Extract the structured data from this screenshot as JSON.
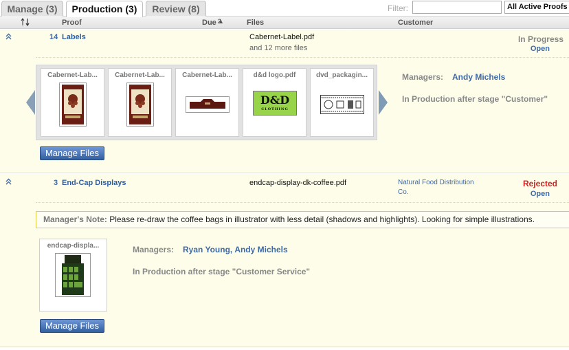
{
  "tabs": [
    {
      "label": "Manage (3)"
    },
    {
      "label": "Production (3)"
    },
    {
      "label": "Review (8)"
    }
  ],
  "filter": {
    "label": "Filter:",
    "value": "",
    "select_value": "All Active Proofs"
  },
  "columns": {
    "proof": "Proof",
    "due": "Due",
    "due_sort_number": "2",
    "files": "Files",
    "customer": "Customer"
  },
  "rows": [
    {
      "count": "14",
      "name": "Labels",
      "file": "Cabernet-Label.pdf",
      "file_more": "and 12 more files",
      "customer_line1": "",
      "customer_line2": "",
      "status": "In Progress",
      "action": "Open",
      "thumbnails": [
        {
          "name": "Cabernet-Lab..."
        },
        {
          "name": "Cabernet-Lab..."
        },
        {
          "name": "Cabernet-Lab..."
        },
        {
          "name": "d&d logo.pdf"
        },
        {
          "name": "dvd_packagin..."
        }
      ],
      "thumb_dd_text": "D&D",
      "thumb_dd_sub": "CLOTHING",
      "managers_label": "Managers:",
      "managers": [
        "Andy Michels"
      ],
      "stage": "In Production after stage \"Customer\"",
      "button": "Manage Files"
    },
    {
      "count": "3",
      "name": "End-Cap Displays",
      "file": "endcap-display-dk-coffee.pdf",
      "customer_line1": "Natural Food Distribution",
      "customer_line2": "Co.",
      "status": "Rejected",
      "action": "Open",
      "note_label": "Manager's Note:",
      "note_text": " Please re-draw the coffee bags in illustrator with less detail (shadows and highlights). Looking for simple illustrations.",
      "thumbnails": [
        {
          "name": "endcap-displa..."
        }
      ],
      "managers_label": "Managers:",
      "managers": [
        "Ryan Young",
        "Andy Michels"
      ],
      "manager_separator": ",",
      "stage": "In Production after stage \"Customer Service\"",
      "button": "Manage Files"
    }
  ],
  "colors": {
    "row_bg": "#fdfde9",
    "link": "#3d6aa8",
    "rejected": "#d02020",
    "button": "#4a74b8"
  }
}
